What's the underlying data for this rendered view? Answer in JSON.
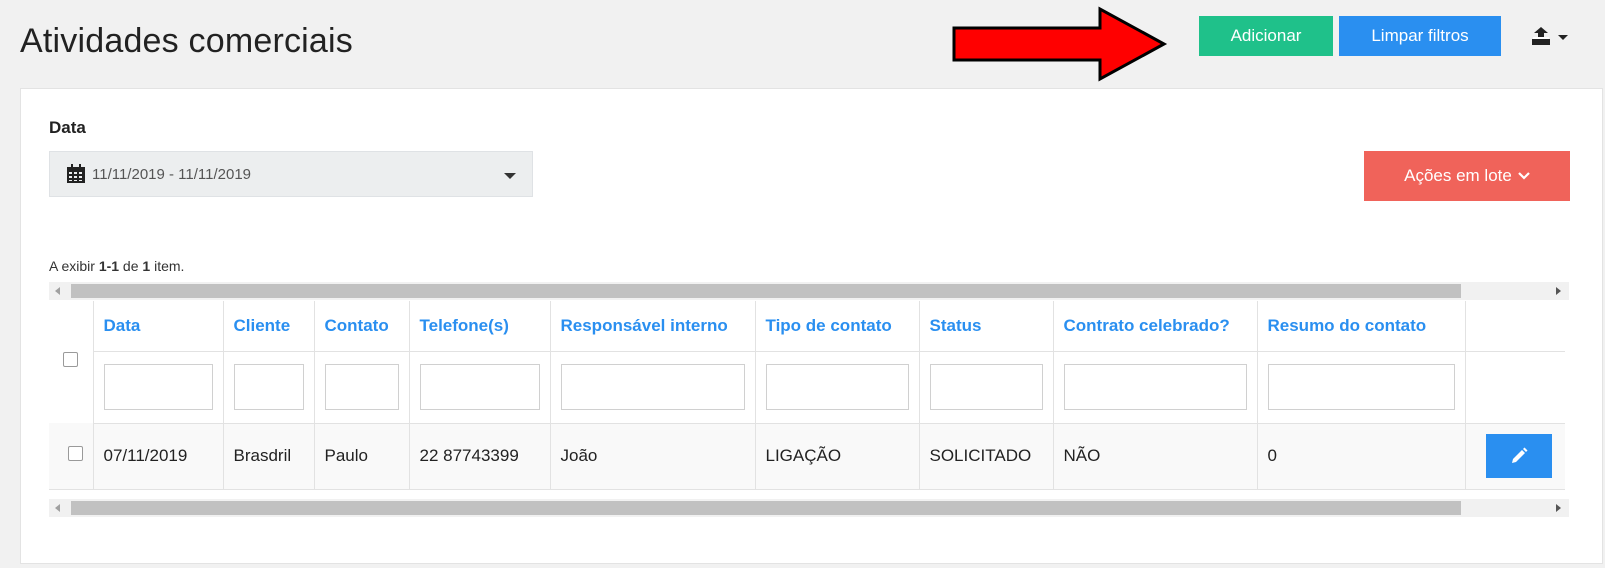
{
  "page": {
    "title": "Atividades comerciais"
  },
  "toolbar": {
    "add_label": "Adicionar",
    "clear_filters_label": "Limpar filtros",
    "export_icon": "export-icon",
    "annotation_arrow_color": "#ff0000"
  },
  "filters": {
    "date_label": "Data",
    "date_value": "11/11/2019 - 11/11/2019",
    "date_icon": "calendar-icon"
  },
  "bulk_actions": {
    "label": "Ações em lote"
  },
  "summary": {
    "prefix": "A exibir ",
    "range": "1-1",
    "middle": " de ",
    "total": "1",
    "suffix": " item."
  },
  "table": {
    "columns": [
      "Data",
      "Cliente",
      "Contato",
      "Telefone(s)",
      "Responsável interno",
      "Tipo de contato",
      "Status",
      "Contrato celebrado?",
      "Resumo do contato"
    ],
    "rows": [
      {
        "cells": [
          "07/11/2019",
          "Brasdril",
          "Paulo",
          "22 87743399",
          "João",
          "LIGAÇÃO",
          "SOLICITADO",
          "NÃO",
          "0"
        ]
      }
    ]
  },
  "colors": {
    "add_button": "#1fc18a",
    "primary": "#2a8ff0",
    "bulk_button": "#f0635a",
    "header_text": "#2a8ff0"
  }
}
